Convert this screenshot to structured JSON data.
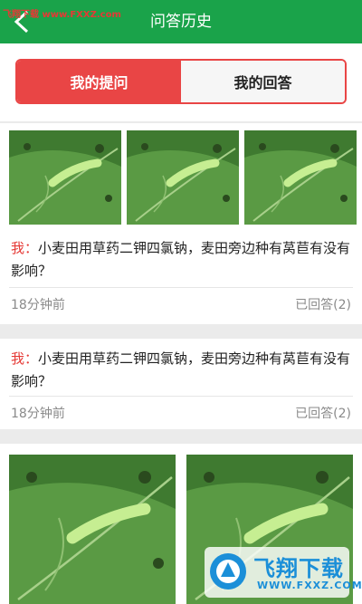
{
  "header": {
    "title": "问答历史",
    "watermark": "飞翔下载 www.FXXZ.com"
  },
  "tabs": [
    {
      "label": "我的提问",
      "active": true
    },
    {
      "label": "我的回答",
      "active": false
    }
  ],
  "questions": [
    {
      "prefix": "我：",
      "text": "小麦田用草药二钾四氯钠，麦田旁边种有莴苣有没有影响？",
      "time": "18分钟前",
      "status": "已回答(2)",
      "image_count": 3
    },
    {
      "prefix": "我：",
      "text": "小麦田用草药二钾四氯钠，麦田旁边种有莴苣有没有影响？",
      "time": "18分钟前",
      "status": "已回答(2)",
      "image_count": 0
    },
    {
      "image_count": 2
    }
  ],
  "watermark_bottom": {
    "title": "飞翔下载",
    "url": "WWW.FXXZ.COM"
  },
  "colors": {
    "header_green": "#1aa34a",
    "accent_red": "#e94545"
  }
}
